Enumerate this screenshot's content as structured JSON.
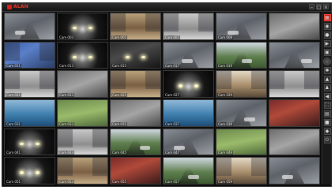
{
  "app": {
    "title": "ALAN",
    "brand_color": "#d2221a",
    "window_buttons": [
      "–",
      "□",
      "×"
    ]
  },
  "cameras": [
    {
      "label": "",
      "scene": "street"
    },
    {
      "label": "Cam 003",
      "scene": "night"
    },
    {
      "label": "Cam 005",
      "scene": "shop"
    },
    {
      "label": "Cam 007",
      "scene": "office"
    },
    {
      "label": "Cam 009",
      "scene": "street"
    },
    {
      "label": "",
      "scene": "gray"
    },
    {
      "label": "Cam 011",
      "scene": "blue"
    },
    {
      "label": "Cam 013",
      "scene": "night"
    },
    {
      "label": "Cam 015",
      "scene": "dark"
    },
    {
      "label": "Cam 017",
      "scene": "street"
    },
    {
      "label": "Cam 019",
      "scene": "park"
    },
    {
      "label": "",
      "scene": "street"
    },
    {
      "label": "Cam 021",
      "scene": "office"
    },
    {
      "label": "Cam 023",
      "scene": "gray"
    },
    {
      "label": "Cam 025",
      "scene": "shop"
    },
    {
      "label": "Cam 027",
      "scene": "night"
    },
    {
      "label": "Cam 029",
      "scene": "lobby"
    },
    {
      "label": "",
      "scene": "office"
    },
    {
      "label": "Cam 031",
      "scene": "water"
    },
    {
      "label": "Cam 033",
      "scene": "green"
    },
    {
      "label": "Cam 035",
      "scene": "gray"
    },
    {
      "label": "Cam 037",
      "scene": "water"
    },
    {
      "label": "Cam 039",
      "scene": "street"
    },
    {
      "label": "",
      "scene": "red"
    },
    {
      "label": "Cam 041",
      "scene": "night"
    },
    {
      "label": "Cam 043",
      "scene": "office"
    },
    {
      "label": "Cam 045",
      "scene": "park"
    },
    {
      "label": "Cam 047",
      "scene": "street"
    },
    {
      "label": "Cam 049",
      "scene": "green"
    },
    {
      "label": "",
      "scene": "gray"
    },
    {
      "label": "Cam 051",
      "scene": "night"
    },
    {
      "label": "Cam 053",
      "scene": "shop"
    },
    {
      "label": "Cam 055",
      "scene": "red"
    },
    {
      "label": "Cam 057",
      "scene": "park"
    },
    {
      "label": "Cam 059",
      "scene": "lobby"
    },
    {
      "label": "",
      "scene": "street"
    }
  ],
  "side_buttons": [
    {
      "icon": "grid-icon",
      "glyph": "▦",
      "active": true
    },
    {
      "icon": "camera-icon",
      "glyph": "◉",
      "active": false
    },
    {
      "icon": "record-icon",
      "glyph": "●",
      "active": false
    },
    {
      "icon": "playback-icon",
      "glyph": "▶",
      "active": false
    },
    {
      "icon": "snapshot-icon",
      "glyph": "▣",
      "active": false
    },
    {
      "icon": "settings-icon",
      "glyph": "✱",
      "active": false
    },
    {
      "icon": "alert-icon",
      "glyph": "▲",
      "active": false
    },
    {
      "icon": "user-icon",
      "glyph": "♟",
      "active": false
    },
    {
      "icon": "volume-icon",
      "glyph": "◀",
      "active": false
    },
    {
      "icon": "fullscreen-icon",
      "glyph": "⛶",
      "active": false
    },
    {
      "icon": "layout-icon",
      "glyph": "▤",
      "active": false
    },
    {
      "icon": "lock-icon",
      "glyph": "■",
      "active": false
    },
    {
      "icon": "network-icon",
      "glyph": "◆",
      "active": false
    },
    {
      "icon": "power-icon",
      "glyph": "⏻",
      "active": false
    }
  ]
}
